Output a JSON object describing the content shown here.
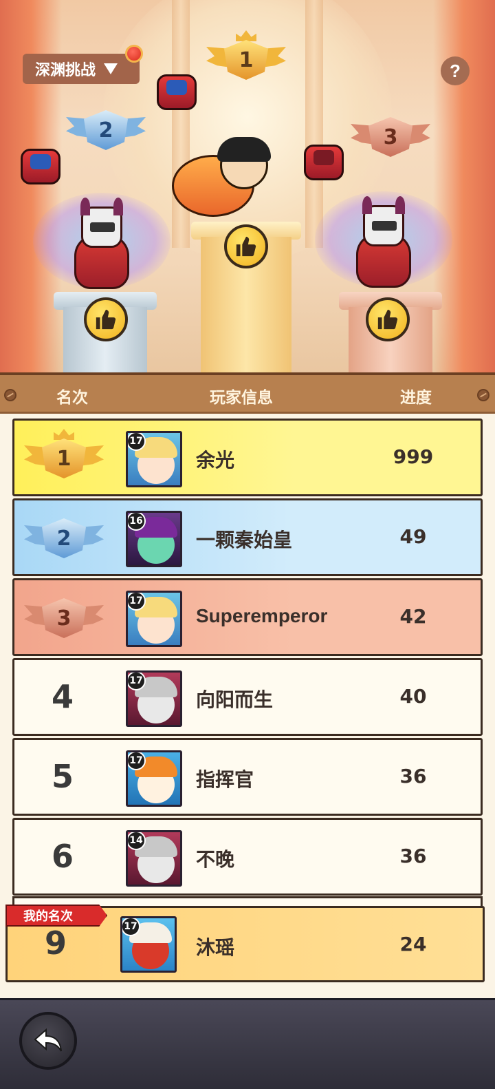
{
  "header": {
    "mode_selector_label": "深渊挑战",
    "help_label": "?"
  },
  "podium": {
    "first": {
      "rank": "1"
    },
    "second": {
      "rank": "2"
    },
    "third": {
      "rank": "3"
    }
  },
  "table": {
    "columns": {
      "rank": "名次",
      "player": "玩家信息",
      "progress": "进度"
    },
    "rows": [
      {
        "rank": "1",
        "level": "17",
        "name": "余光",
        "score": "999",
        "avatar": "blonde-avatar"
      },
      {
        "rank": "2",
        "level": "16",
        "name": "一颗秦始皇",
        "score": "49",
        "avatar": "purple-avatar"
      },
      {
        "rank": "3",
        "level": "17",
        "name": "Superemperor",
        "score": "42",
        "avatar": "blonde-avatar"
      },
      {
        "rank": "4",
        "level": "17",
        "name": "向阳而生",
        "score": "40",
        "avatar": "knight-avatar"
      },
      {
        "rank": "5",
        "level": "17",
        "name": "指挥官",
        "score": "36",
        "avatar": "hood-avatar"
      },
      {
        "rank": "6",
        "level": "14",
        "name": "不晚",
        "score": "36",
        "avatar": "knight-avatar"
      }
    ]
  },
  "my_rank": {
    "tag": "我的名次",
    "rank": "9",
    "level": "17",
    "name": "沐瑶",
    "score": "24"
  },
  "colors": {
    "gold_row": "#fff05a",
    "silver_row": "#a9d8f6",
    "bronze_row": "#f2a58c",
    "header_bar": "#b7804f",
    "my_rank_tag": "#d92b2b"
  }
}
